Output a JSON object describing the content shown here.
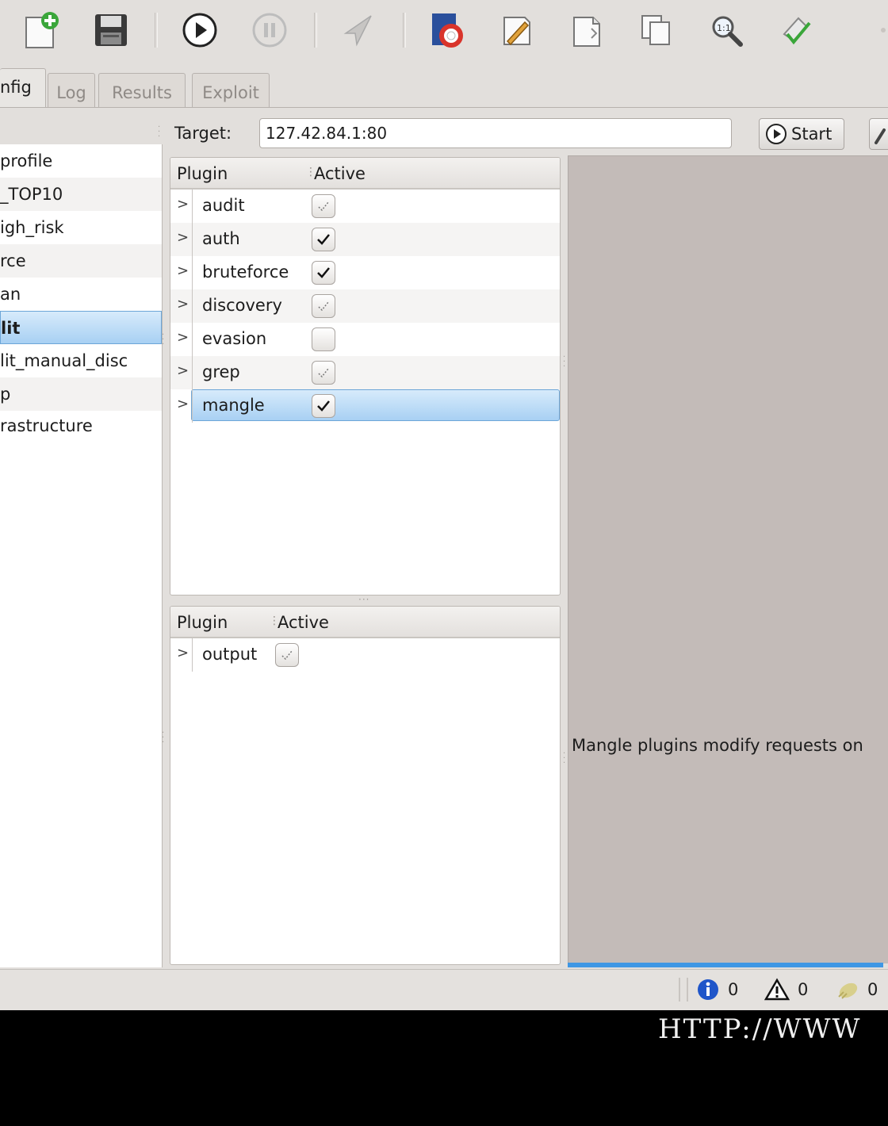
{
  "tabs": [
    {
      "label": "nfig",
      "active": true
    },
    {
      "label": "Log",
      "active": false
    },
    {
      "label": "Results",
      "active": false
    },
    {
      "label": "Exploit",
      "active": false
    }
  ],
  "toolbar": {
    "icons": [
      "new-profile-icon",
      "save-icon",
      "play-icon",
      "pause-icon",
      "launch-icon",
      "help-icon",
      "edit-icon",
      "document-icon",
      "copy-icon",
      "zoom-icon",
      "clear-icon"
    ]
  },
  "target": {
    "label": "Target:",
    "value": "127.42.84.1:80",
    "start_label": "Start"
  },
  "profiles": [
    {
      "label": "profile"
    },
    {
      "label": "_TOP10"
    },
    {
      "label": "igh_risk"
    },
    {
      "label": "rce"
    },
    {
      "label": "an"
    },
    {
      "label": "lit",
      "selected": true
    },
    {
      "label": "lit_manual_disc"
    },
    {
      "label": "p"
    },
    {
      "label": "rastructure"
    }
  ],
  "plugins_table": {
    "col_plugin": "Plugin",
    "col_active": "Active",
    "rows": [
      {
        "name": "audit",
        "state": "partial"
      },
      {
        "name": "auth",
        "state": "checked"
      },
      {
        "name": "bruteforce",
        "state": "checked"
      },
      {
        "name": "discovery",
        "state": "partial"
      },
      {
        "name": "evasion",
        "state": "unchecked"
      },
      {
        "name": "grep",
        "state": "partial"
      },
      {
        "name": "mangle",
        "state": "checked",
        "selected": true
      }
    ]
  },
  "output_table": {
    "col_plugin": "Plugin",
    "col_active": "Active",
    "rows": [
      {
        "name": "output",
        "state": "partial"
      }
    ]
  },
  "description": "Mangle plugins modify requests on",
  "status": {
    "info_count": "0",
    "warning_count": "0",
    "error_count": "0"
  },
  "footer": "HTTP://WWW",
  "colors": {
    "selection": "#a8d0f3",
    "progress": "#3f97e4",
    "info": "#1f55c9"
  }
}
